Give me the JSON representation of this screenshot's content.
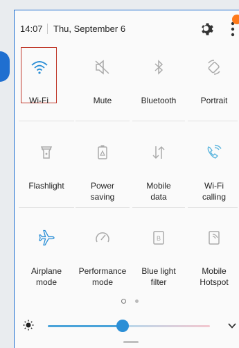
{
  "status": {
    "time": "14:07",
    "date": "Thu, September 6"
  },
  "colors": {
    "accent": "#2b8fd6",
    "highlight": "#c0392b",
    "notification": "#ff7a1a"
  },
  "tiles": [
    {
      "label": "Wi-Fi",
      "icon": "wifi-icon",
      "active": true
    },
    {
      "label": "Mute",
      "icon": "mute-icon",
      "active": false
    },
    {
      "label": "Bluetooth",
      "icon": "bluetooth-icon",
      "active": false
    },
    {
      "label": "Portrait",
      "icon": "rotation-icon",
      "active": false
    },
    {
      "label": "Flashlight",
      "icon": "flashlight-icon",
      "active": false
    },
    {
      "label": "Power\nsaving",
      "icon": "battery-icon",
      "active": false
    },
    {
      "label": "Mobile\ndata",
      "icon": "data-arrows-icon",
      "active": false
    },
    {
      "label": "Wi-Fi\ncalling",
      "icon": "wifi-calling-icon",
      "active": true
    },
    {
      "label": "Airplane\nmode",
      "icon": "airplane-icon",
      "active": true
    },
    {
      "label": "Performance\nmode",
      "icon": "gauge-icon",
      "active": false
    },
    {
      "label": "Blue light\nfilter",
      "icon": "blue-light-icon",
      "active": false
    },
    {
      "label": "Mobile\nHotspot",
      "icon": "hotspot-icon",
      "active": false
    }
  ],
  "brightness": {
    "level": 0.46
  }
}
